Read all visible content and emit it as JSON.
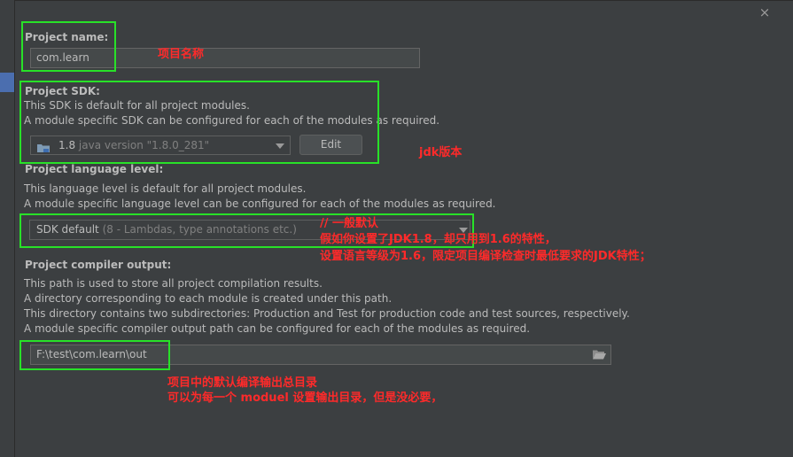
{
  "colors": {
    "background": "#3c3f41",
    "field": "#45494a",
    "highlight": "#28e128",
    "annotation": "#ff2a2a",
    "selection": "#4b6eaf"
  },
  "dialog": {
    "close_icon": "×"
  },
  "project_name": {
    "label": "Project name:",
    "value": "com.learn"
  },
  "project_sdk": {
    "label": "Project SDK:",
    "desc1": "This SDK is default for all project modules.",
    "desc2": "A module specific SDK can be configured for each of the modules as required.",
    "version": "1.8",
    "version_detail": "java version \"1.8.0_281\"",
    "edit_label": "Edit",
    "icon": "folder-icon"
  },
  "language_level": {
    "label": "Project language level:",
    "desc1": "This language level is default for all project modules.",
    "desc2": "A module specific language level can be configured for each of the modules as required.",
    "value": "SDK default",
    "value_detail": "(8 - Lambdas, type annotations etc.)"
  },
  "compiler_output": {
    "label": "Project compiler output:",
    "desc1": "This path is used to store all project compilation results.",
    "desc2": "A directory corresponding to each module is created under this path.",
    "desc3": "This directory contains two subdirectories: Production and Test for production code and test sources, respectively.",
    "desc4": "A module specific compiler output path can be configured for each of the modules as required.",
    "value": "F:\\test\\com.learn\\out",
    "browse_icon": "folder-open-icon"
  },
  "annotations": {
    "name": "项目名称",
    "jdk": "jdk版本",
    "level_1": "// 一般默认",
    "level_2": "假如你设置了JDK1.8，却只用到1.6的特性，",
    "level_3": "设置语言等级为1.6，限定项目编译检查时最低要求的JDK特性；",
    "output_1": "项目中的默认编译输出总目录",
    "output_2": "可以为每一个 moduel 设置输出目录，但是没必要，"
  }
}
